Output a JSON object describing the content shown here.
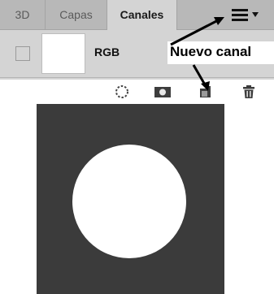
{
  "tabs": [
    {
      "label": "3D"
    },
    {
      "label": "Capas"
    },
    {
      "label": "Canales",
      "active": true
    }
  ],
  "channel_row": {
    "label": "RGB"
  },
  "tooltip": {
    "text": "Nuevo canal"
  },
  "toolbar_icons": [
    "load-selection-icon",
    "save-selection-as-channel-icon",
    "new-channel-icon",
    "trash-icon"
  ],
  "colors": {
    "panel_bg": "#d4d4d4",
    "tab_bar": "#b8b8b8",
    "canvas_bg": "#3b3b3b",
    "circle": "#ffffff"
  }
}
